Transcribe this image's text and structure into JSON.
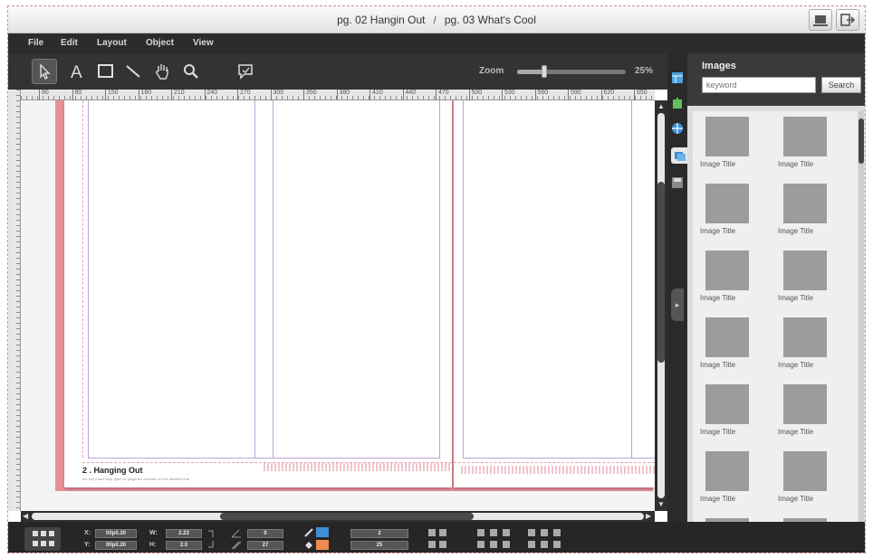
{
  "window": {
    "page_left": "pg. 02 Hangin Out",
    "separator": "/",
    "page_right": "pg. 03 What's Cool"
  },
  "titlebar_buttons": [
    {
      "name": "fullscreen-icon"
    },
    {
      "name": "exit-icon"
    }
  ],
  "menu": [
    "File",
    "Edit",
    "Layout",
    "Object",
    "View"
  ],
  "tools": [
    "select-arrow-icon",
    "text-tool-icon",
    "rectangle-tool-icon",
    "line-tool-icon",
    "hand-tool-icon",
    "zoom-tool-icon",
    "comment-icon"
  ],
  "zoom": {
    "label": "Zoom",
    "value": "25%",
    "level": 0.25
  },
  "ruler_ticks": [
    "80",
    "80",
    "150",
    "180",
    "210",
    "240",
    "270",
    "300",
    "350",
    "380",
    "410",
    "440",
    "470",
    "500",
    "530",
    "560",
    "590",
    "620",
    "650"
  ],
  "page": {
    "title": "2 . Hanging Out",
    "note": "Do not place any type or graphics outside of the dashed line."
  },
  "side_tabs": [
    "layout-icon",
    "page-icon",
    "color-icon",
    "images-icon",
    "save-icon"
  ],
  "images_panel": {
    "title": "Images",
    "search_placeholder": "keyword",
    "search_button": "Search",
    "items": [
      "Image Title",
      "Image Title",
      "Image Title",
      "Image Title",
      "Image Title",
      "Image Title",
      "Image Title",
      "Image Title",
      "Image Title",
      "Image Title",
      "Image Title",
      "Image Title"
    ]
  },
  "bottom": {
    "x_label": "X:",
    "x_value": "00p0.20",
    "y_label": "Y:",
    "y_value": "00p0.20",
    "w_label": "W:",
    "w_value": "2.23",
    "h_label": "H:",
    "h_value": "2.0",
    "angle_value": "0",
    "skew_value": "27",
    "stroke_value": "2",
    "opacity_value": "25"
  },
  "colors": {
    "stroke": "#3f8fd8",
    "fill": "#f08a50",
    "bleed": "#e98f99"
  }
}
